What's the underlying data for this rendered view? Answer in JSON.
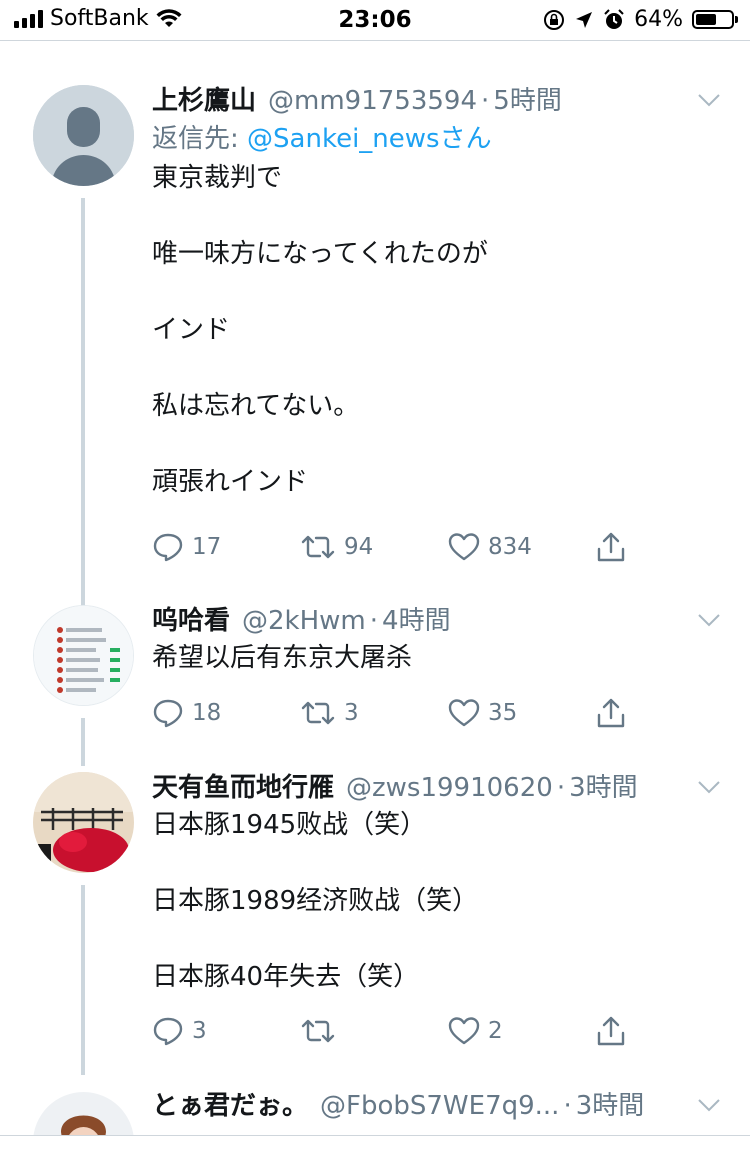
{
  "status_bar": {
    "carrier": "SoftBank",
    "time": "23:06",
    "battery": "64%",
    "battery_level": 0.64
  },
  "tweets": [
    {
      "name": "上杉鷹山",
      "handle": "@mm91753594",
      "separator": "·",
      "time": "5時間",
      "reply_prefix": "返信先: ",
      "reply_mention": "@Sankei_news",
      "reply_suffix": "さん",
      "lines": [
        "東京裁判で",
        "唯一味方になってくれたのが",
        "インド",
        "私は忘れてない。",
        "頑張れインド"
      ],
      "replies": "17",
      "retweets": "94",
      "likes": "834",
      "avatar_icon": "default-person-icon"
    },
    {
      "name": "呜哈看",
      "handle": "@2kHwm",
      "separator": "·",
      "time": "4時間",
      "lines": [
        "希望以后有东京大屠杀"
      ],
      "replies": "18",
      "retweets": "3",
      "likes": "35",
      "avatar_icon": "screenshot-list-thumbnail"
    },
    {
      "name": "天有鱼而地行雁",
      "handle": "@zws19910620",
      "separator": "·",
      "time": "3時間",
      "lines": [
        "日本豚1945败战（笑）",
        "日本豚1989经济败战（笑）",
        "日本豚40年失去（笑）"
      ],
      "replies": "3",
      "retweets": "",
      "likes": "2",
      "avatar_icon": "motorcycle-photo-thumbnail"
    },
    {
      "name": "とぁ君だぉ。",
      "handle": "@FbobS7WE7q9...",
      "separator": "·",
      "time": "3時間",
      "avatar_icon": "anime-character-thumbnail"
    }
  ],
  "colors": {
    "link_blue": "#1da1f2",
    "secondary_gray": "#657786",
    "thread_line": "#ccd6dd"
  }
}
